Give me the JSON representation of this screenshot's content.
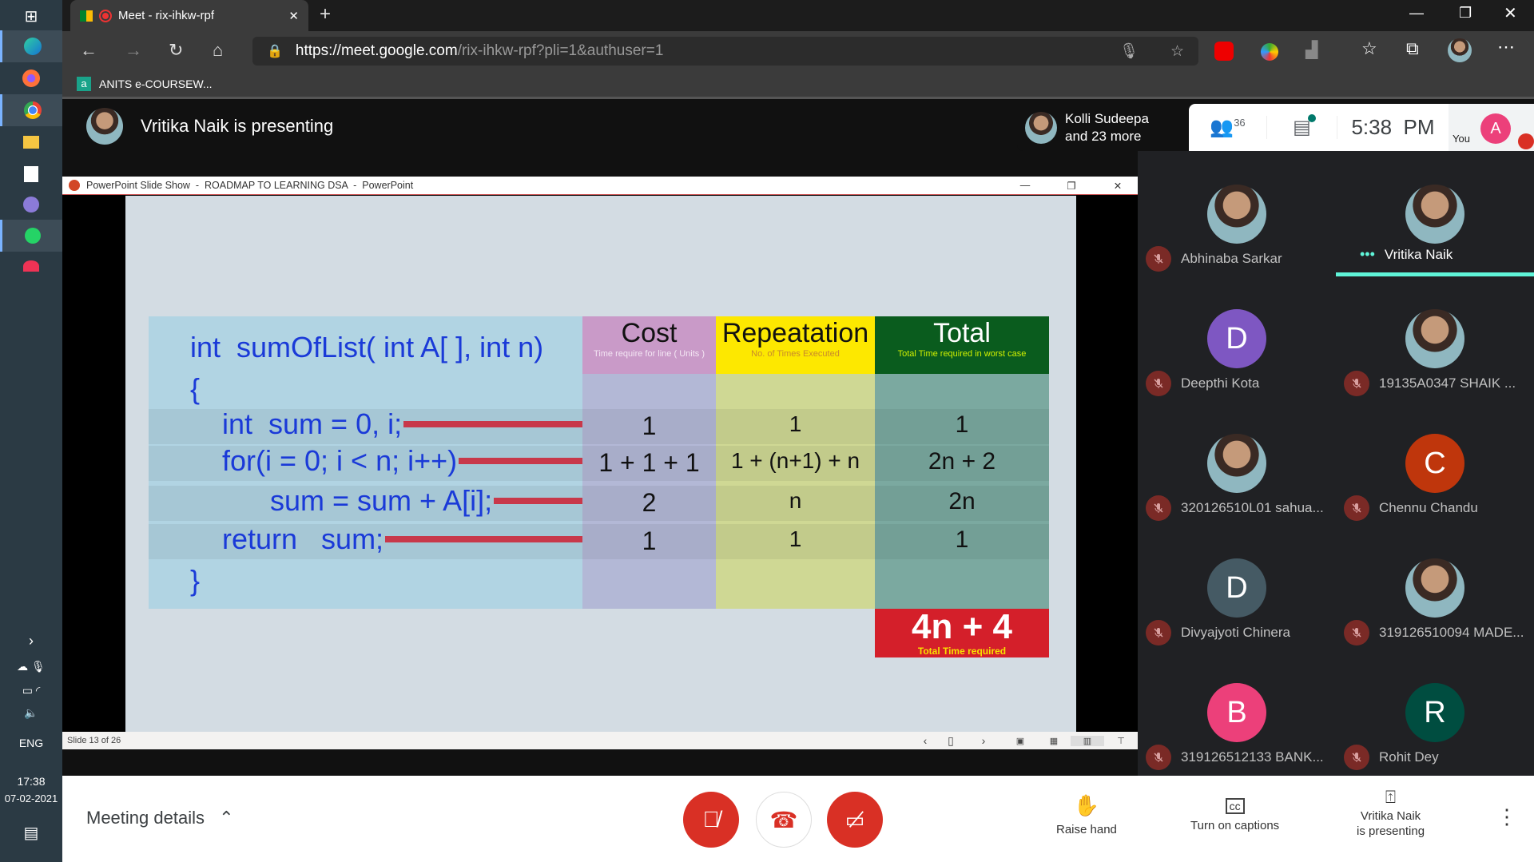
{
  "taskbar": {
    "lang": "ENG",
    "time": "17:38",
    "date": "07-02-2021",
    "icons": [
      "windows-start",
      "edge",
      "firefox",
      "chrome",
      "file-explorer",
      "store",
      "app",
      "whatsapp",
      "app2"
    ]
  },
  "browser": {
    "tab_title": "Meet - rix-ihkw-rpf",
    "url_host": "https://meet.google.com",
    "url_path": "/rix-ihkw-rpf?pli=1&authuser=1",
    "bookmark": "ANITS e-COURSEW..."
  },
  "meet": {
    "presenting_banner": "Vritika Naik is presenting",
    "speakers_line1": "Kolli Sudeepa",
    "speakers_line2": "and 23 more",
    "participant_count": "36",
    "clock": "5:38  PM",
    "you_label": "You",
    "you_initial": "A",
    "participants": [
      {
        "name": "Abhinaba Sarkar",
        "initial": "",
        "color": "photo",
        "muted": true
      },
      {
        "name": "Vritika Naik",
        "initial": "",
        "color": "photo",
        "muted": false,
        "speaking": true
      },
      {
        "name": "Deepthi Kota",
        "initial": "D",
        "color": "#7e57c2",
        "muted": true
      },
      {
        "name": "19135A0347 SHAIK ...",
        "initial": "",
        "color": "photo",
        "muted": true
      },
      {
        "name": "320126510L01 sahua...",
        "initial": "",
        "color": "photo",
        "muted": true
      },
      {
        "name": "Chennu Chandu",
        "initial": "C",
        "color": "#bf360c",
        "muted": true
      },
      {
        "name": "Divyajyoti Chinera",
        "initial": "D",
        "color": "#455a64",
        "muted": true
      },
      {
        "name": "319126510094 MADE...",
        "initial": "",
        "color": "photo",
        "muted": true
      },
      {
        "name": "319126512133 BANK...",
        "initial": "B",
        "color": "#ec407a",
        "muted": true
      },
      {
        "name": "Rohit Dey",
        "initial": "R",
        "color": "#004d40",
        "muted": true
      }
    ],
    "bottom": {
      "meeting_details": "Meeting details",
      "raise_hand": "Raise hand",
      "captions": "Turn on captions",
      "presenting_line1": "Vritika Naik",
      "presenting_line2": "is presenting"
    },
    "accent": "#5ff4d8",
    "danger": "#d93025"
  },
  "ppt": {
    "window_title": "PowerPoint Slide Show  -  ROADMAP TO LEARNING DSA  -  PowerPoint",
    "status": "Slide 13 of 26",
    "slide": {
      "headers": [
        {
          "title": "Cost",
          "sub": "Time require for line ( Units )"
        },
        {
          "title": "Repeatation",
          "sub": "No. of Times Executed"
        },
        {
          "title": "Total",
          "sub": "Total Time required in worst case"
        }
      ],
      "signature": "int  sumOfList( int A[ ], int n)",
      "open_brace": "{",
      "close_brace": "}",
      "rows": [
        {
          "code": "int  sum = 0, i;",
          "cost": "1",
          "rep": "1",
          "total": "1"
        },
        {
          "code": "for(i = 0; i < n; i++)",
          "cost": "1 + 1 + 1",
          "rep": "1 + (n+1) + n",
          "total": "2n + 2"
        },
        {
          "code": "sum = sum + A[i];",
          "cost": "2",
          "rep": "n",
          "total": "2n"
        },
        {
          "code": "return   sum;",
          "cost": "1",
          "rep": "1",
          "total": "1"
        }
      ],
      "result": "4n + 4",
      "result_sub": "Total Time required"
    }
  }
}
